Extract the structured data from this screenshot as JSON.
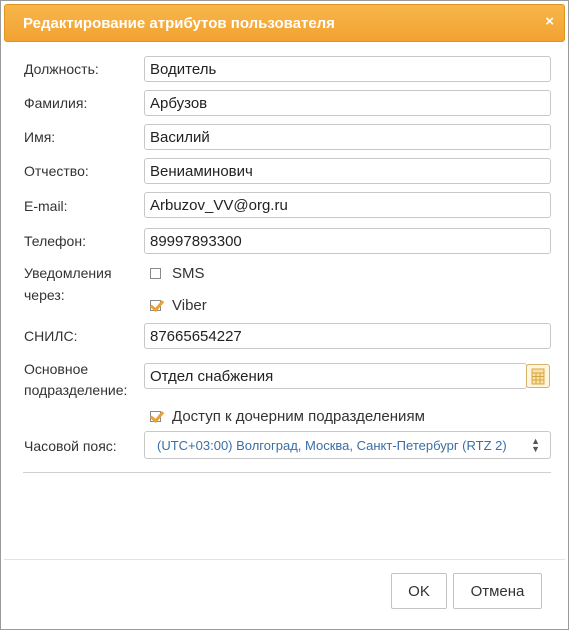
{
  "dialog": {
    "title": "Редактирование атрибутов пользователя",
    "close_glyph": "×"
  },
  "fields": {
    "position": {
      "label": "Должность:",
      "value": "Водитель"
    },
    "last_name": {
      "label": "Фамилия:",
      "value": "Арбузов"
    },
    "first_name": {
      "label": "Имя:",
      "value": "Василий"
    },
    "patronymic": {
      "label": "Отчество:",
      "value": "Вениаминович"
    },
    "email": {
      "label": "E-mail:",
      "value": "Arbuzov_VV@org.ru"
    },
    "phone": {
      "label": "Телефон:",
      "value": "89997893300"
    },
    "notifications": {
      "label_line1": "Уведомления",
      "label_line2": "через:",
      "sms": {
        "label": "SMS",
        "checked": false
      },
      "viber": {
        "label": "Viber",
        "checked": true
      }
    },
    "snils": {
      "label": "СНИЛС:",
      "value": "87665654227"
    },
    "department": {
      "label_line1": "Основное",
      "label_line2": "подразделение:",
      "value": "Отдел снабжения",
      "lookup_icon": "table-lookup-icon"
    },
    "subdepartments_access": {
      "label": "Доступ к дочерним подразделениям",
      "checked": true
    },
    "timezone": {
      "label": "Часовой пояс:",
      "value": "(UTC+03:00) Волгоград, Москва, Санкт-Петербург (RTZ 2)"
    }
  },
  "buttons": {
    "ok": "OK",
    "cancel": "Отмена"
  },
  "colors": {
    "title_bar": "#f2a231",
    "checkmark": "#e8a236",
    "select_text": "#3a6ea5"
  }
}
